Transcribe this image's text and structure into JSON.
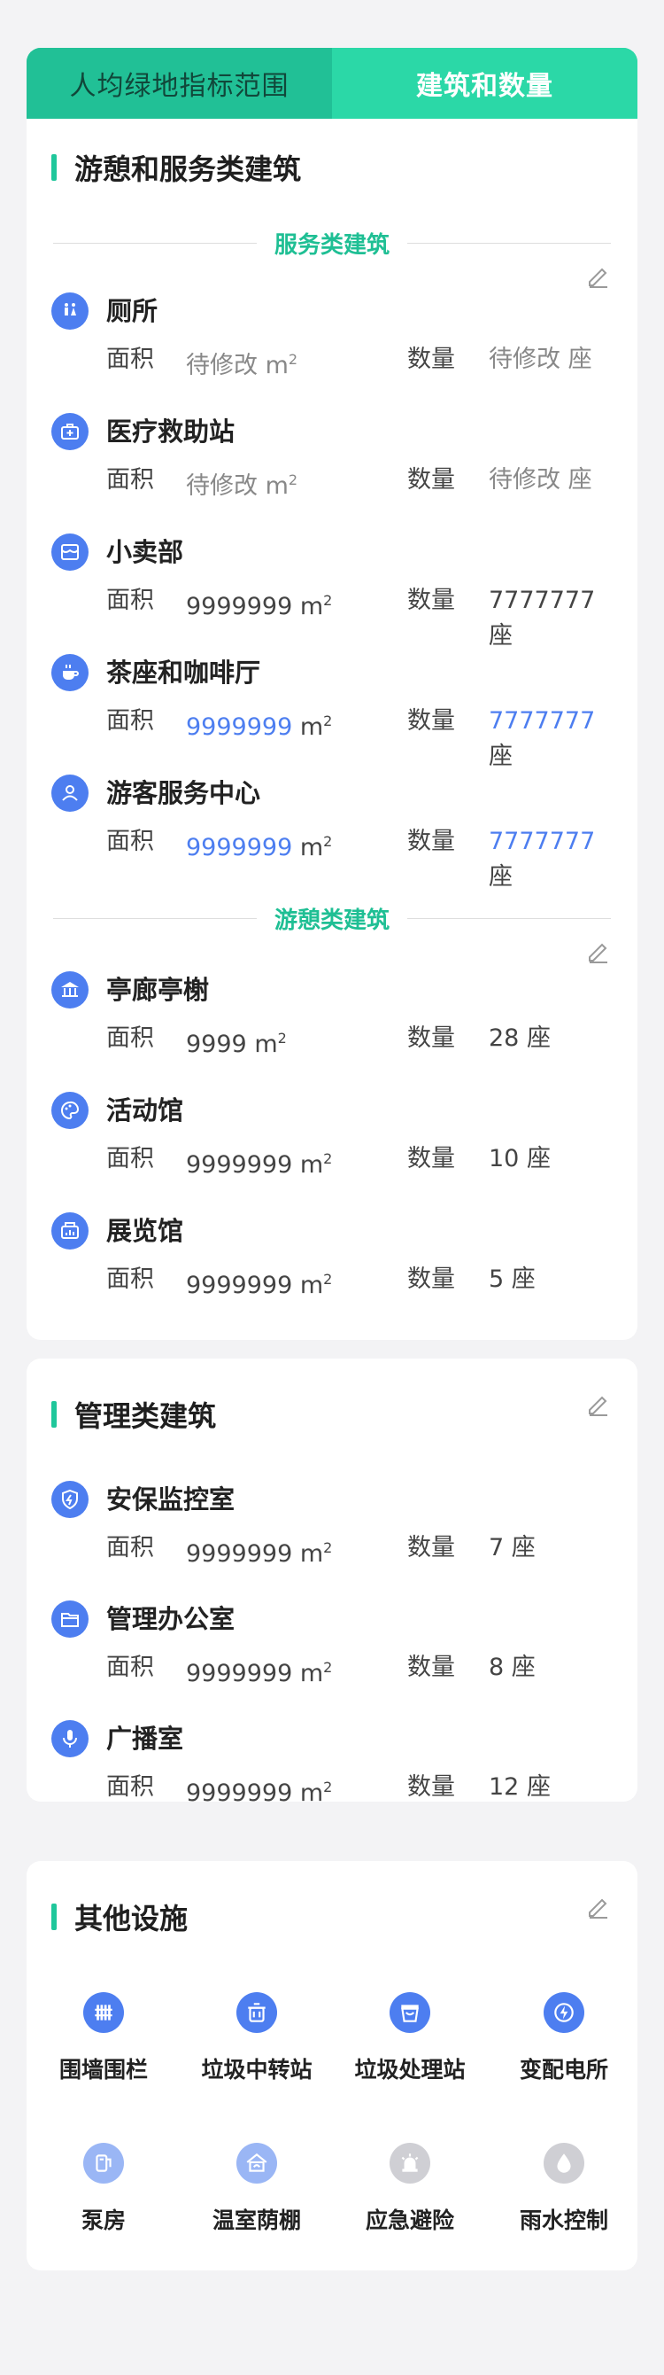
{
  "tabs": [
    {
      "label": "人均绿地指标范围"
    },
    {
      "label": "建筑和数量"
    }
  ],
  "section1": {
    "title": "游憩和服务类建筑",
    "service_divider": "服务类建筑",
    "recreation_divider": "游憩类建筑"
  },
  "labels": {
    "area": "面积",
    "count": "数量",
    "area_unit": "m",
    "area_sup": "2",
    "count_unit": "座"
  },
  "service_items": [
    {
      "name": "厕所",
      "area": "待修改",
      "count": "待修改",
      "icon": "toilet-icon"
    },
    {
      "name": "医疗救助站",
      "area": "待修改",
      "count": "待修改",
      "icon": "medical-kit-icon"
    },
    {
      "name": "小卖部",
      "area": "9999999",
      "count": "7777777",
      "icon": "shop-icon"
    },
    {
      "name": "茶座和咖啡厅",
      "area": "9999999",
      "count": "7777777",
      "icon": "coffee-icon"
    },
    {
      "name": "游客服务中心",
      "area": "9999999",
      "count": "7777777",
      "icon": "service-person-icon"
    }
  ],
  "recreation_items": [
    {
      "name": "亭廊亭榭",
      "area": "9999",
      "count": "28",
      "icon": "pavilion-icon"
    },
    {
      "name": "活动馆",
      "area": "9999999",
      "count": "10",
      "icon": "palette-icon"
    },
    {
      "name": "展览馆",
      "area": "9999999",
      "count": "5",
      "icon": "exhibition-icon"
    }
  ],
  "section2": {
    "title": "管理类建筑",
    "items": [
      {
        "name": "安保监控室",
        "area": "9999999",
        "count": "7",
        "icon": "shield-icon"
      },
      {
        "name": "管理办公室",
        "area": "9999999",
        "count": "8",
        "icon": "folder-icon"
      },
      {
        "name": "广播室",
        "area": "9999999",
        "count": "12",
        "icon": "microphone-icon"
      }
    ]
  },
  "section3": {
    "title": "其他设施",
    "items": [
      {
        "label": "围墙围栏",
        "icon": "fence-icon"
      },
      {
        "label": "垃圾中转站",
        "icon": "trash-can-icon"
      },
      {
        "label": "垃圾处理站",
        "icon": "waste-box-icon"
      },
      {
        "label": "变配电所",
        "icon": "lightning-icon"
      },
      {
        "label": "泵房",
        "icon": "pump-icon"
      },
      {
        "label": "温室荫棚",
        "icon": "greenhouse-icon"
      },
      {
        "label": "应急避险",
        "icon": "alarm-icon"
      },
      {
        "label": "雨水控制",
        "icon": "water-drop-icon"
      }
    ]
  },
  "colors": {
    "accent_green": "#1fc79b",
    "icon_blue": "#4d7ef0",
    "value_blue": "#4d7ef0",
    "pending_grey": "#888888"
  }
}
